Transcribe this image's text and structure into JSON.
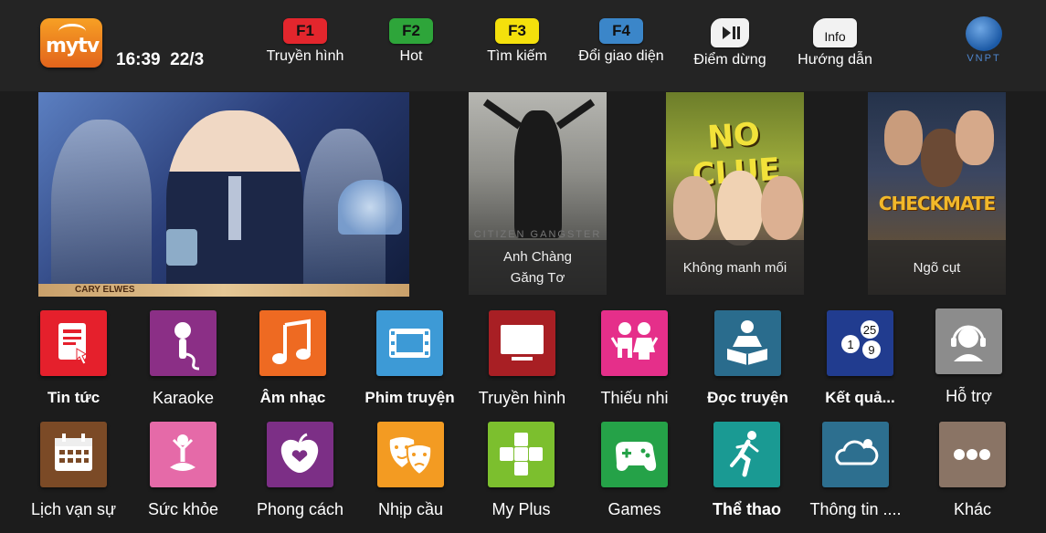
{
  "header": {
    "logo_text": "mytv",
    "time": "16:39",
    "date": "22/3",
    "fkeys": [
      {
        "key": "F1",
        "label": "Truyền hình",
        "color": "#e3262d"
      },
      {
        "key": "F2",
        "label": "Hot",
        "color": "#2ea53a"
      },
      {
        "key": "F3",
        "label": "Tìm kiếm",
        "color": "#f4e00c"
      },
      {
        "key": "F4",
        "label": "Đổi giao diện",
        "color": "#3b86c9"
      }
    ],
    "pause": {
      "label": "Điểm dừng",
      "icon": "play-pause-icon"
    },
    "info": {
      "key": "Info",
      "label": "Hướng dẫn"
    },
    "brand": "VNPT"
  },
  "featured": {
    "hero_caption": "CARY ELWES",
    "posters": [
      {
        "title": "Anh Chàng Găng Tơ",
        "title_line1": "Anh Chàng",
        "title_line2": "Găng Tơ",
        "art_text": "CITIZEN GANGSTER"
      },
      {
        "title": "Không manh mối",
        "art_text": "NO CLUE"
      },
      {
        "title": "Ngõ cụt",
        "art_text": "CHECKMATE"
      }
    ]
  },
  "menu_row1": [
    {
      "label": "Tin tức",
      "icon": "news-icon",
      "color": "#e5202c"
    },
    {
      "label": "Karaoke",
      "icon": "microphone-icon",
      "color": "#8b2f86"
    },
    {
      "label": "Âm nhạc",
      "icon": "music-note-icon",
      "color": "#ee6a22"
    },
    {
      "label": "Phim truyện",
      "icon": "film-icon",
      "color": "#3d9ad6"
    },
    {
      "label": "Truyền hình",
      "icon": "tv-icon",
      "color": "#a81f24"
    },
    {
      "label": "Thiếu nhi",
      "icon": "children-icon",
      "color": "#e52f8a"
    },
    {
      "label": "Đọc truyện",
      "icon": "reading-icon",
      "color": "#2a6c8d"
    },
    {
      "label": "Kết quả...",
      "icon": "lottery-balls-icon",
      "color": "#213c8f",
      "balls": [
        "25",
        "1",
        "9"
      ]
    },
    {
      "label": "Hỗ trợ",
      "icon": "support-headset-icon",
      "color": "#8c8c8c"
    }
  ],
  "menu_row2": [
    {
      "label": "Lịch vạn sự",
      "icon": "calendar-icon",
      "color": "#7b4a26"
    },
    {
      "label": "Sức khỏe",
      "icon": "yoga-icon",
      "color": "#e56aa8"
    },
    {
      "label": "Phong cách",
      "icon": "style-apple-icon",
      "color": "#7c2f86"
    },
    {
      "label": "Nhịp cầu",
      "icon": "theater-masks-icon",
      "color": "#f39b22"
    },
    {
      "label": "My Plus",
      "icon": "plus-icon",
      "color": "#7cbf2e"
    },
    {
      "label": "Games",
      "icon": "gamepad-icon",
      "color": "#25a248"
    },
    {
      "label": "Thể thao",
      "icon": "running-icon",
      "color": "#1a9a93"
    },
    {
      "label": "Thông tin ....",
      "icon": "weather-cloud-icon",
      "color": "#2d6f8f"
    },
    {
      "label": "Khác",
      "icon": "more-dots-icon",
      "color": "#8a7465"
    }
  ]
}
